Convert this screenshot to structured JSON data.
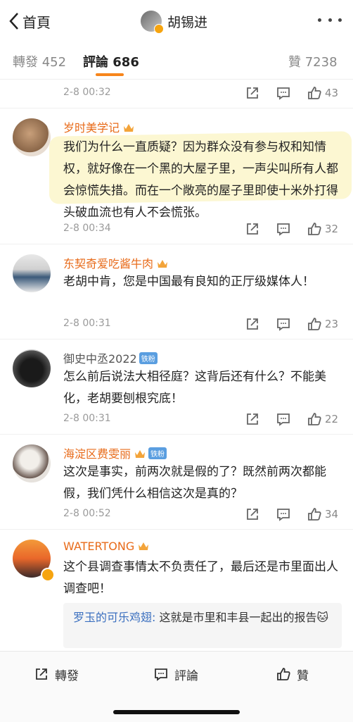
{
  "topbar": {
    "back_label": "首頁",
    "title": "胡锡进"
  },
  "tabs": {
    "repost": "轉發 452",
    "comment": "評論 686",
    "like": "贊 7238"
  },
  "comments": [
    {
      "date": "2-8 00:32",
      "likes": "43"
    },
    {
      "user": "岁时美学记",
      "text": "我们为什么一直质疑？因为群众没有参与权和知情权，就好像在一个黑的大屋子里，一声尖叫所有人都会惊慌失措。而在一个敞亮的屋子里即使十米外打得头破血流也有人不会慌张。",
      "date": "2-8 00:34",
      "likes": "32"
    },
    {
      "user": "东契奇爱吃酱牛肉",
      "text": "老胡中肯，您是中国最有良知的正厅级媒体人！",
      "date": "2-8 00:31",
      "likes": "23"
    },
    {
      "user": "御史中丞2022",
      "fan_badge": "铁粉",
      "text": "怎么前后说法大相径庭？这背后还有什么？不能美化，老胡要刨根究底！",
      "date": "2-8 00:31",
      "likes": "22"
    },
    {
      "user": "海淀区费雯丽",
      "fan_badge": "铁粉",
      "text": "这次是事实，前两次就是假的了？既然前两次都能假，我们凭什么相信这次是真的？",
      "date": "2-8 00:52",
      "likes": "34"
    },
    {
      "user": "WATERTONG",
      "text": "这个县调查事情太不负责任了，最后还是市里面出人调查吧！",
      "reply": {
        "user": "罗玉的可乐鸡翅:",
        "text": " 这就是市里和丰县一起出的报告",
        "emoji": "🐱"
      }
    }
  ],
  "bottombar": {
    "repost": "轉發",
    "comment": "評論",
    "like": "贊"
  },
  "colors": {
    "accent": "#f7851b",
    "username": "#e86b1a",
    "reply_user": "#3a6fbf"
  },
  "icons": [
    "back-chevron-icon",
    "more-icon",
    "repost-icon",
    "comment-icon",
    "like-icon",
    "crown-icon",
    "verified-icon"
  ]
}
